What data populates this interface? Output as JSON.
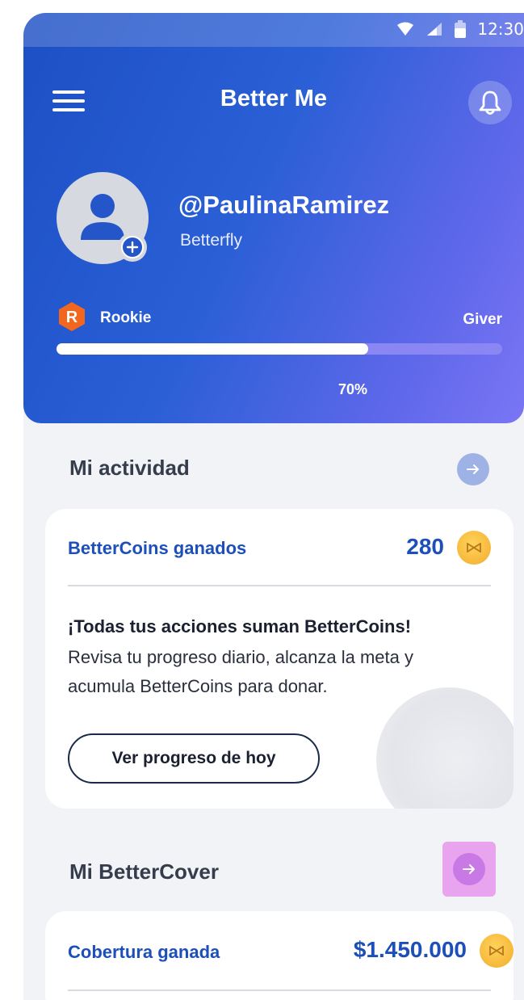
{
  "status_bar": {
    "time": "12:30"
  },
  "header": {
    "title": "Better Me",
    "username": "@PaulinaRamirez",
    "company": "Betterfly",
    "level_letter": "R",
    "level_label": "Rookie",
    "next_level_label": "Giver",
    "progress_percent": 70,
    "progress_text": "70%"
  },
  "activity": {
    "section_title": "Mi actividad",
    "card": {
      "coins_label": "BetterCoins ganados",
      "coins_value": "280",
      "promo_title": "¡Todas tus acciones suman BetterCoins!",
      "promo_body": "Revisa tu progreso diario, alcanza la meta y acumula BetterCoins para donar.",
      "button_label": "Ver progreso de hoy"
    }
  },
  "cover": {
    "section_title": "Mi BetterCover",
    "card": {
      "coverage_label": "Cobertura ganada",
      "coverage_value": "$1.450.000"
    }
  },
  "colors": {
    "brand_blue": "#1d4fb8",
    "coin_gold": "#f6b83a",
    "arrow_blue": "#9fb2e6",
    "arrow_pink": "#e8a4ef"
  }
}
